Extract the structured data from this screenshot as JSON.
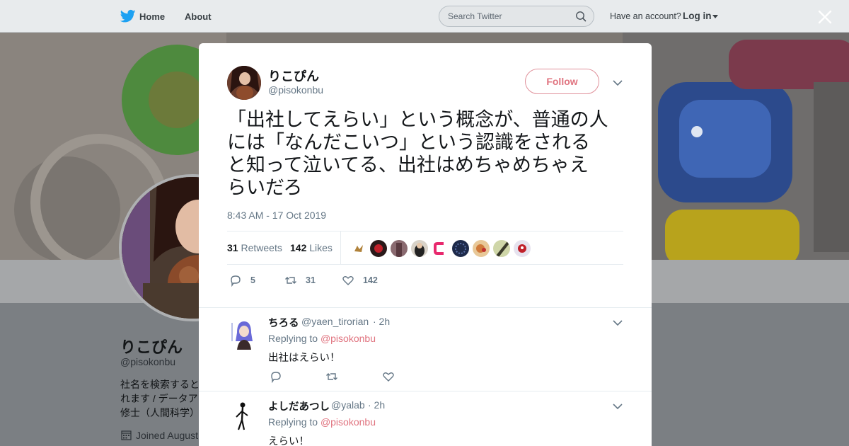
{
  "colors": {
    "accent": "#e0737f",
    "muted": "#657786",
    "nav_bg": "#e8ebed"
  },
  "nav": {
    "home": "Home",
    "about": "About",
    "search_placeholder": "Search Twitter",
    "have_account": "Have an account?",
    "login": "Log in"
  },
  "profile": {
    "name": "りこぴん",
    "handle": "@pisokonbu",
    "bio": "社名を検索すると\nれます / データア\n修士（人間科学）",
    "joined": "Joined August"
  },
  "tweet": {
    "author_name": "りこぴん",
    "author_handle": "@pisokonbu",
    "follow_label": "Follow",
    "text": "「出社してえらい」という概念が、普通の人\nには「なんだこいつ」という認識をされる\nと知って泣いてる、出社はめちゃめちゃえ\nらいだろ",
    "timestamp": "8:43 AM - 17 Oct 2019",
    "retweets_count": "31",
    "retweets_label": "Retweets",
    "likes_count": "142",
    "likes_label": "Likes",
    "actions": {
      "replies": "5",
      "retweets": "31",
      "likes": "142"
    }
  },
  "replies": [
    {
      "name": "ちろる",
      "handle": "@yaen_tirorian",
      "time": "· 2h",
      "replying_prefix": "Replying to",
      "mention": "@pisokonbu",
      "text": "出社はえらい！"
    },
    {
      "name": "よしだあつし",
      "handle": "@yalab",
      "time": "· 2h",
      "replying_prefix": "Replying to",
      "mention": "@pisokonbu",
      "text": "えらい！"
    }
  ]
}
